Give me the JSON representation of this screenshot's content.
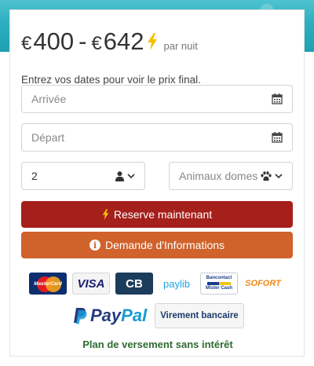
{
  "price": {
    "currency_symbol": "€",
    "min": "400",
    "separator": "-",
    "max": "642",
    "per_night": "par nuit"
  },
  "info_text": "Entrez vos dates pour voir le prix final.",
  "form": {
    "arrival_placeholder": "Arrivée",
    "departure_placeholder": "Départ",
    "guests_value": "2",
    "pets_placeholder": "Animaux domes"
  },
  "buttons": {
    "reserve_label": "Reserve maintenant",
    "info_label": "Demande d'Informations"
  },
  "payment_methods": {
    "mastercard": "MasterCard",
    "visa": "VISA",
    "cb": "CB",
    "paylib": "paylib",
    "bancontact_line1": "Bancontact",
    "bancontact_line2": "Mister Cash",
    "sofort": "SOFORT",
    "paypal_1": "Pay",
    "paypal_2": "Pal",
    "virement": "Virement bancaire"
  },
  "plan_text": "Plan de versement sans intérêt",
  "colors": {
    "reserve_button": "#a51f1b",
    "info_button": "#d0622b",
    "bolt": "#f2c200",
    "plan_text": "#2e6b31"
  },
  "icons": [
    "bolt-icon",
    "calendar-icon",
    "user-icon",
    "chevron-down-icon",
    "paw-icon",
    "info-circle-icon"
  ]
}
